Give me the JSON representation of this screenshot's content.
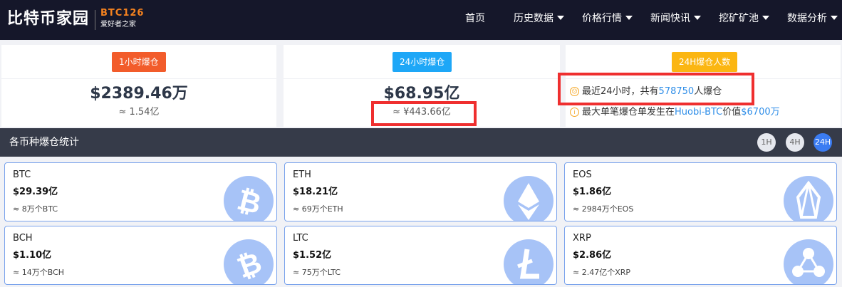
{
  "header": {
    "logo_cn": "比特币家园",
    "logo_en": "BTC126",
    "logo_sub": "爱好者之家",
    "nav": [
      "首页",
      "历史数据",
      "价格行情",
      "新闻快讯",
      "挖矿矿池",
      "数据分析"
    ]
  },
  "stats": [
    {
      "tag": "1小时爆仓",
      "amount": "$2389.46万",
      "approx": "≈ 1.54亿",
      "color": "#f25c2b"
    },
    {
      "tag": "24小时爆仓",
      "amount": "$68.95亿",
      "approx": "≈ ¥443.66亿",
      "color": "#1ea7f7"
    },
    {
      "tag": "24H爆仓人数",
      "color": "#fbb612",
      "line1": {
        "pre": "最近24小时，共有",
        "num": "578750",
        "post": "人爆仓"
      },
      "line2": {
        "pre": "最大单笔爆仓单发生在",
        "exchange": "Huobi-BTC",
        "mid": "价值",
        "value": "$6700万"
      }
    }
  ],
  "section": {
    "title": "各币种爆仓统计",
    "ranges": [
      "1H",
      "4H",
      "24H"
    ],
    "active_range": "24H"
  },
  "coins": [
    {
      "symbol": "BTC",
      "value": "$29.39亿",
      "sub": "≈ 8万个BTC",
      "icon": "bitcoin-icon"
    },
    {
      "symbol": "ETH",
      "value": "$18.21亿",
      "sub": "≈ 69万个ETH",
      "icon": "ethereum-icon"
    },
    {
      "symbol": "EOS",
      "value": "$1.86亿",
      "sub": "≈ 2984万个EOS",
      "icon": "eos-icon"
    },
    {
      "symbol": "BCH",
      "value": "$1.10亿",
      "sub": "≈ 14万个BCH",
      "icon": "bitcoin-cash-icon"
    },
    {
      "symbol": "LTC",
      "value": "$1.52亿",
      "sub": "≈ 75万个LTC",
      "icon": "litecoin-icon"
    },
    {
      "symbol": "XRP",
      "value": "$2.86亿",
      "sub": "≈ 2.47亿个XRP",
      "icon": "ripple-icon"
    }
  ],
  "colors": {
    "nav_bg": "#15172a",
    "logo_accent": "#f5821f",
    "highlight": "#ef2f2f",
    "link": "#2f8ee8",
    "card_border": "#7aa3ec",
    "coin_icon": "#a7c3f7",
    "active_pill": "#3b7cf2"
  }
}
